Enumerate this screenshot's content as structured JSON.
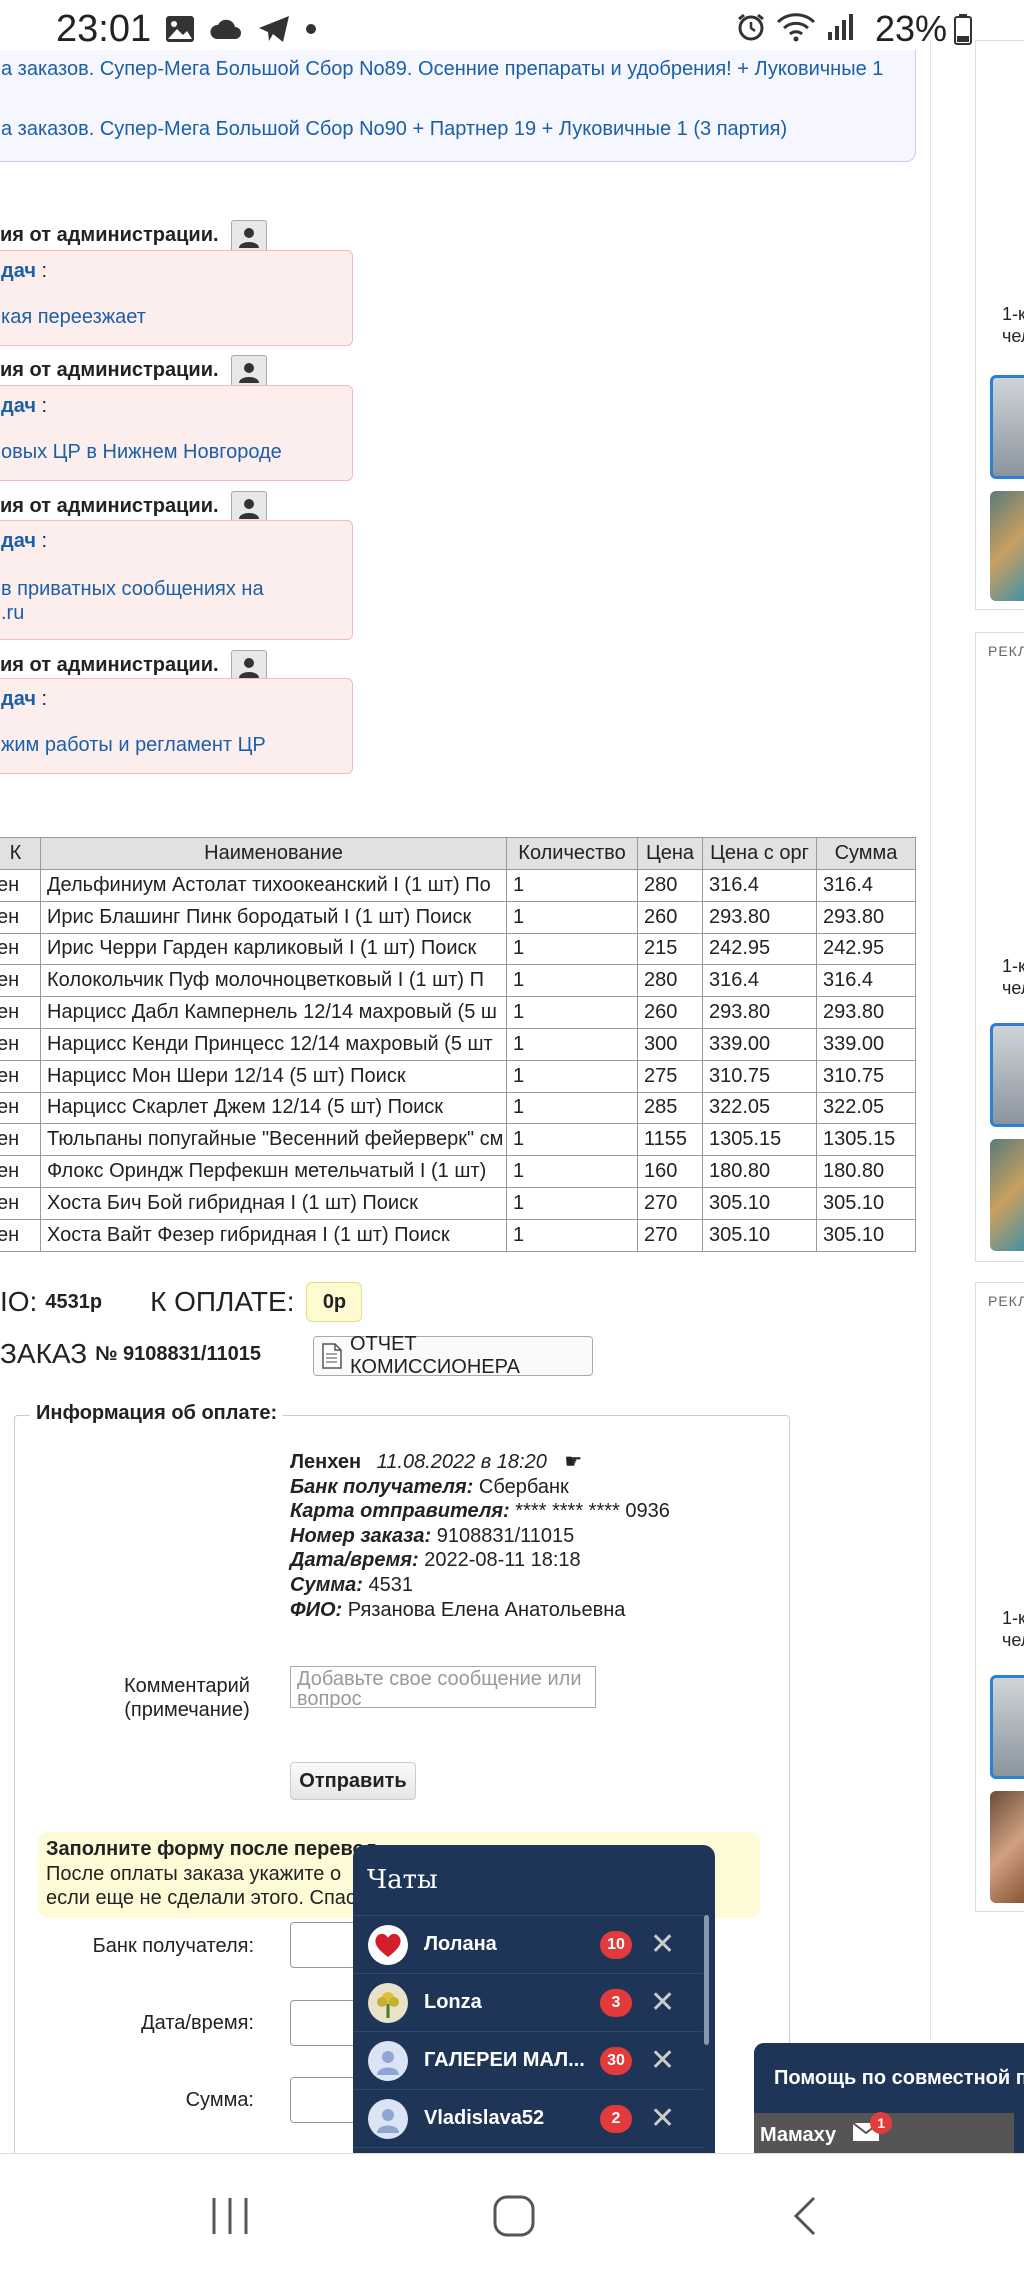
{
  "status": {
    "time": "23:01",
    "battery": "23%"
  },
  "news": [
    "а заказов. Супер-Мега Большой Сбор No89. Осенние препараты и удобрения! + Луковичные 1",
    "а заказов. Супер-Мега Большой Сбор No90 + Партнер 19 + Луковичные 1 (3 партия)"
  ],
  "admin_messages": [
    {
      "title": "ия от администрации.",
      "sender": "дач",
      "sep": " :",
      "text": [
        "кая переезжает"
      ]
    },
    {
      "title": "ия от администрации.",
      "sender": "дач",
      "sep": " :",
      "text": [
        "овых ЦР в Нижнем Новгороде"
      ]
    },
    {
      "title": "ия от администрации.",
      "sender": "дач",
      "sep": " :",
      "text": [
        "в приватных сообщениях на",
        ".ru"
      ]
    },
    {
      "title": "ия от администрации.",
      "sender": "дач",
      "sep": " :",
      "text": [
        "жим работы и регламент ЦР"
      ]
    }
  ],
  "table": {
    "headers": [
      "К",
      "Наименование",
      "Количество",
      "Цена",
      "Цена с орг",
      "Сумма"
    ],
    "rows": [
      [
        "ен",
        "Дельфиниум Астолат тихоокеанский I (1 шт) По",
        "1",
        "280",
        "316.4",
        "316.4"
      ],
      [
        "ен",
        "Ирис Блашинг Пинк бородатый I (1 шт) Поиск",
        "1",
        "260",
        "293.80",
        "293.80"
      ],
      [
        "ен",
        "Ирис Черри Гарден карликовый I (1 шт) Поиск",
        "1",
        "215",
        "242.95",
        "242.95"
      ],
      [
        "ен",
        "Колокольчик Пуф молочноцветковый I (1 шт) П",
        "1",
        "280",
        "316.4",
        "316.4"
      ],
      [
        "ен",
        "Нарцисс Дабл Кампернель 12/14 махровый (5 ш",
        "1",
        "260",
        "293.80",
        "293.80"
      ],
      [
        "ен",
        "Нарцисс Кенди Принцесс 12/14 махровый (5 шт",
        "1",
        "300",
        "339.00",
        "339.00"
      ],
      [
        "ен",
        "Нарцисс Мон Шери 12/14 (5 шт) Поиск",
        "1",
        "275",
        "310.75",
        "310.75"
      ],
      [
        "ен",
        "Нарцисс Скарлет Джем 12/14 (5 шт) Поиск",
        "1",
        "285",
        "322.05",
        "322.05"
      ],
      [
        "ен",
        "Тюльпаны попугайные \"Весенний фейерверк\" см",
        "1",
        "1155",
        "1305.15",
        "1305.15"
      ],
      [
        "ен",
        "Флокс Ориндж Перфекшн метельчатый I (1 шт)",
        "1",
        "160",
        "180.80",
        "180.80"
      ],
      [
        "ен",
        "Хоста Бич Бой гибридная I (1 шт) Поиск",
        "1",
        "270",
        "305.10",
        "305.10"
      ],
      [
        "ен",
        "Хоста Вайт Фезер гибридная I (1 шт) Поиск",
        "1",
        "270",
        "305.10",
        "305.10"
      ]
    ]
  },
  "totals": {
    "paid_label": "IO:",
    "paid_value": "4531р",
    "topay_label": "К ОПЛАТЕ:",
    "topay_value": "0р"
  },
  "order": {
    "label": "ЗАКАЗ",
    "number": "№ 9108831/11015",
    "report_button": "ОТЧЕТ КОМИССИОНЕРА"
  },
  "payment": {
    "legend": "Информация об оплате:",
    "author": "Ленхен",
    "date": "11.08.2022 в 18:20",
    "bank_label": "Банк получателя:",
    "bank": "Сбербанк",
    "card_label": "Карта отправителя:",
    "card": "**** **** **** 0936",
    "order_label": "Номер заказа:",
    "order_no": "9108831/11015",
    "datetime_label": "Дата/время:",
    "datetime": "2022-08-11 18:18",
    "sum_label": "Сумма:",
    "sum": "4531",
    "fio_label": "ФИО:",
    "fio": "Рязанова Елена Анатольевна"
  },
  "comment": {
    "label1": "Комментарий",
    "label2": "(примечание)",
    "placeholder": "Добавьте свое сообщение или вопрос",
    "send": "Отправить"
  },
  "notice": {
    "title": "Заполните форму после перевод",
    "line1": "После оплаты заказа укажите о",
    "line2": "если еще не сделали этого. Спас"
  },
  "form": {
    "bank": "Банк получателя:",
    "datetime": "Дата/время:",
    "sum": "Сумма:"
  },
  "chats": {
    "title": "Чаты",
    "items": [
      {
        "name": "Лолана",
        "count": "10"
      },
      {
        "name": "Lonza",
        "count": "3"
      },
      {
        "name": "ГАЛЕРЕИ МАЛ...",
        "count": "30"
      },
      {
        "name": "Vladislava52",
        "count": "2"
      }
    ]
  },
  "help": {
    "title": "Помощь по совместной по",
    "tab": "Мамаху",
    "badge": "1"
  },
  "side": {
    "ad_label": "РЕКЛ",
    "ad_text1": "1-к",
    "ad_text2": "чел"
  }
}
